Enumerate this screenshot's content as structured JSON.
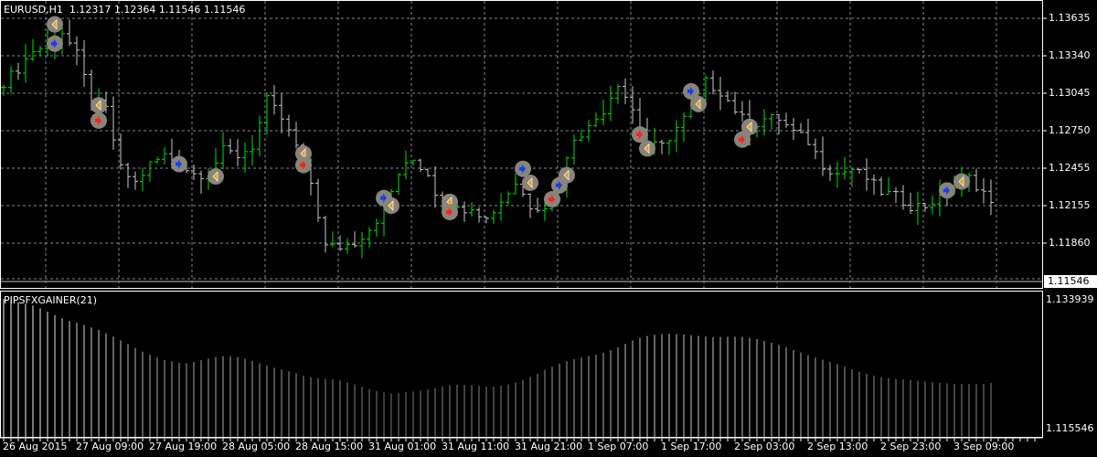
{
  "header": {
    "symbol": "EURUSD,H1",
    "open": "1.12317",
    "high": "1.12364",
    "low": "1.11546",
    "close": "1.11546"
  },
  "indicator": {
    "name": "PIPSFXGAINER(21)",
    "max_label": "1.133939",
    "min_label": "1.115546",
    "max": 1.133939,
    "min": 1.115546
  },
  "price_axis": {
    "labels": [
      "1.13635",
      "1.13340",
      "1.13045",
      "1.12750",
      "1.12455",
      "1.12155",
      "1.11860"
    ],
    "current": "1.11546",
    "top": 1.13635,
    "step": 0.00295
  },
  "time_axis": [
    "26 Aug 2015",
    "27 Aug 09:00",
    "27 Aug 19:00",
    "28 Aug 05:00",
    "28 Aug 15:00",
    "31 Aug 01:00",
    "31 Aug 11:00",
    "31 Aug 21:00",
    "1 Sep 07:00",
    "1 Sep 17:00",
    "2 Sep 03:00",
    "2 Sep 13:00",
    "2 Sep 23:00",
    "3 Sep 09:00"
  ],
  "colors": {
    "up": "#00e000",
    "down": "#c8c8c8",
    "grid": "#7a8a9a",
    "buy": "#1040ff",
    "sell": "#ff2020",
    "exit": "#e0a020",
    "marker_bg": "#8a8478"
  },
  "price_series": [
    1.13131,
    1.13239,
    1.13383,
    1.13419,
    1.13527,
    1.13347,
    1.12987,
    1.12916,
    1.12448,
    1.1234,
    1.12484,
    1.12556,
    1.12484,
    1.12412,
    1.12412,
    1.12592,
    1.12556,
    1.12628,
    1.12987,
    1.12844,
    1.12628,
    1.1234,
    1.11836,
    1.11836,
    1.11872,
    1.1198,
    1.12124,
    1.12412,
    1.1252,
    1.12412,
    1.12124,
    1.12124,
    1.1216,
    1.12052,
    1.12196,
    1.1234,
    1.1216,
    1.1216,
    1.1234,
    1.127,
    1.12772,
    1.12916,
    1.13131,
    1.12916,
    1.12628,
    1.12628,
    1.12772,
    1.12916,
    1.13131,
    1.13059,
    1.12916,
    1.12772,
    1.12844,
    1.12844,
    1.12736,
    1.12664,
    1.12484,
    1.12412,
    1.12448,
    1.12376,
    1.12268,
    1.12232,
    1.1216,
    1.1216,
    1.12232,
    1.12304,
    1.12376,
    1.12268,
    1.12052
  ],
  "signals": [
    {
      "i": 7,
      "price": 1.13587,
      "type": "exit"
    },
    {
      "i": 7,
      "price": 1.13435,
      "type": "buy"
    },
    {
      "i": 13,
      "price": 1.1295,
      "type": "exit"
    },
    {
      "i": 13,
      "price": 1.1283,
      "type": "sell"
    },
    {
      "i": 24,
      "price": 1.12487,
      "type": "buy"
    },
    {
      "i": 29,
      "price": 1.1239,
      "type": "exit"
    },
    {
      "i": 41,
      "price": 1.1257,
      "type": "exit"
    },
    {
      "i": 41,
      "price": 1.1248,
      "type": "sell"
    },
    {
      "i": 52,
      "price": 1.1222,
      "type": "buy"
    },
    {
      "i": 53,
      "price": 1.1216,
      "type": "exit"
    },
    {
      "i": 61,
      "price": 1.1219,
      "type": "exit"
    },
    {
      "i": 61,
      "price": 1.1211,
      "type": "sell"
    },
    {
      "i": 71,
      "price": 1.1245,
      "type": "buy"
    },
    {
      "i": 72,
      "price": 1.1234,
      "type": "exit"
    },
    {
      "i": 75,
      "price": 1.1221,
      "type": "sell"
    },
    {
      "i": 76,
      "price": 1.1232,
      "type": "buy"
    },
    {
      "i": 77,
      "price": 1.124,
      "type": "exit"
    },
    {
      "i": 87,
      "price": 1.1272,
      "type": "sell"
    },
    {
      "i": 88,
      "price": 1.1261,
      "type": "exit"
    },
    {
      "i": 94,
      "price": 1.1306,
      "type": "buy"
    },
    {
      "i": 95,
      "price": 1.1296,
      "type": "exit"
    },
    {
      "i": 101,
      "price": 1.1268,
      "type": "sell"
    },
    {
      "i": 102,
      "price": 1.1278,
      "type": "exit"
    },
    {
      "i": 129,
      "price": 1.1228,
      "type": "buy"
    },
    {
      "i": 131,
      "price": 1.1235,
      "type": "exit"
    }
  ]
}
